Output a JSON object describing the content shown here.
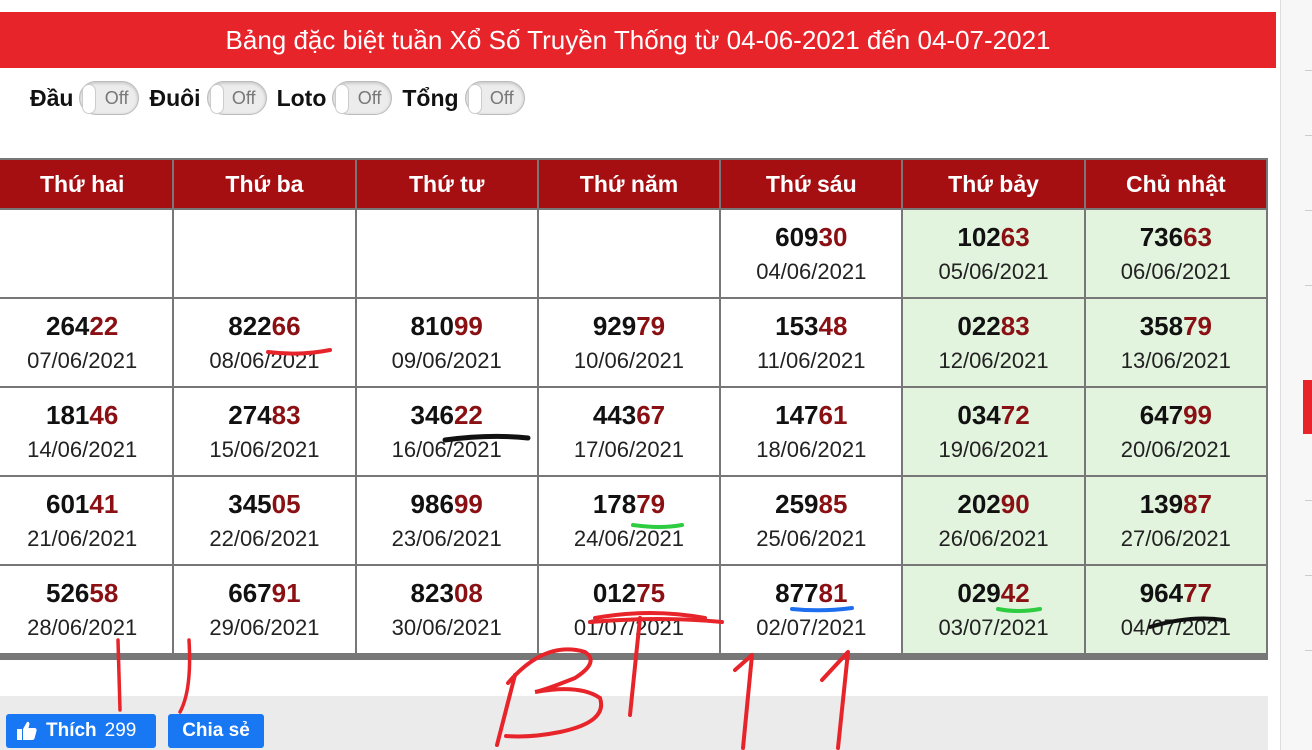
{
  "header": {
    "title": "Bảng đặc biệt tuần Xổ Số Truyền Thống từ 04-06-2021 đến 04-07-2021"
  },
  "toggles": [
    {
      "label": "Đầu",
      "state": "Off"
    },
    {
      "label": "Đuôi",
      "state": "Off"
    },
    {
      "label": "Loto",
      "state": "Off"
    },
    {
      "label": "Tổng",
      "state": "Off"
    }
  ],
  "table": {
    "headers": [
      "Thứ hai",
      "Thứ ba",
      "Thứ tư",
      "Thứ năm",
      "Thứ sáu",
      "Thứ bảy",
      "Chủ nhật"
    ],
    "rows": [
      [
        null,
        null,
        null,
        null,
        {
          "head": "609",
          "tail": "30",
          "date": "04/06/2021"
        },
        {
          "head": "102",
          "tail": "63",
          "date": "05/06/2021"
        },
        {
          "head": "736",
          "tail": "63",
          "date": "06/06/2021"
        }
      ],
      [
        {
          "head": "264",
          "tail": "22",
          "date": "07/06/2021"
        },
        {
          "head": "822",
          "tail": "66",
          "date": "08/06/2021"
        },
        {
          "head": "810",
          "tail": "99",
          "date": "09/06/2021"
        },
        {
          "head": "929",
          "tail": "79",
          "date": "10/06/2021"
        },
        {
          "head": "153",
          "tail": "48",
          "date": "11/06/2021"
        },
        {
          "head": "022",
          "tail": "83",
          "date": "12/06/2021"
        },
        {
          "head": "358",
          "tail": "79",
          "date": "13/06/2021"
        }
      ],
      [
        {
          "head": "181",
          "tail": "46",
          "date": "14/06/2021"
        },
        {
          "head": "274",
          "tail": "83",
          "date": "15/06/2021"
        },
        {
          "head": "346",
          "tail": "22",
          "date": "16/06/2021"
        },
        {
          "head": "443",
          "tail": "67",
          "date": "17/06/2021"
        },
        {
          "head": "147",
          "tail": "61",
          "date": "18/06/2021"
        },
        {
          "head": "034",
          "tail": "72",
          "date": "19/06/2021"
        },
        {
          "head": "647",
          "tail": "99",
          "date": "20/06/2021"
        }
      ],
      [
        {
          "head": "601",
          "tail": "41",
          "date": "21/06/2021"
        },
        {
          "head": "345",
          "tail": "05",
          "date": "22/06/2021"
        },
        {
          "head": "986",
          "tail": "99",
          "date": "23/06/2021"
        },
        {
          "head": "178",
          "tail": "79",
          "date": "24/06/2021"
        },
        {
          "head": "259",
          "tail": "85",
          "date": "25/06/2021"
        },
        {
          "head": "202",
          "tail": "90",
          "date": "26/06/2021"
        },
        {
          "head": "139",
          "tail": "87",
          "date": "27/06/2021"
        }
      ],
      [
        {
          "head": "526",
          "tail": "58",
          "date": "28/06/2021"
        },
        {
          "head": "667",
          "tail": "91",
          "date": "29/06/2021"
        },
        {
          "head": "823",
          "tail": "08",
          "date": "30/06/2021"
        },
        {
          "head": "012",
          "tail": "75",
          "date": "01/07/2021"
        },
        {
          "head": "877",
          "tail": "81",
          "date": "02/07/2021"
        },
        {
          "head": "029",
          "tail": "42",
          "date": "03/07/2021"
        },
        {
          "head": "964",
          "tail": "77",
          "date": "04/07/2021"
        }
      ]
    ]
  },
  "social": {
    "like_label": "Thích",
    "like_count": "299",
    "share_label": "Chia sẻ",
    "like_icon": "thumbs-up-icon"
  },
  "colors": {
    "title_bg": "#e8242b",
    "header_bg": "#a50f12",
    "tail_color": "#8b1014",
    "weekend_bg": "#e2f3de",
    "facebook_blue": "#1877f2"
  },
  "annotation": {
    "handwritten_text": "BT 11"
  }
}
